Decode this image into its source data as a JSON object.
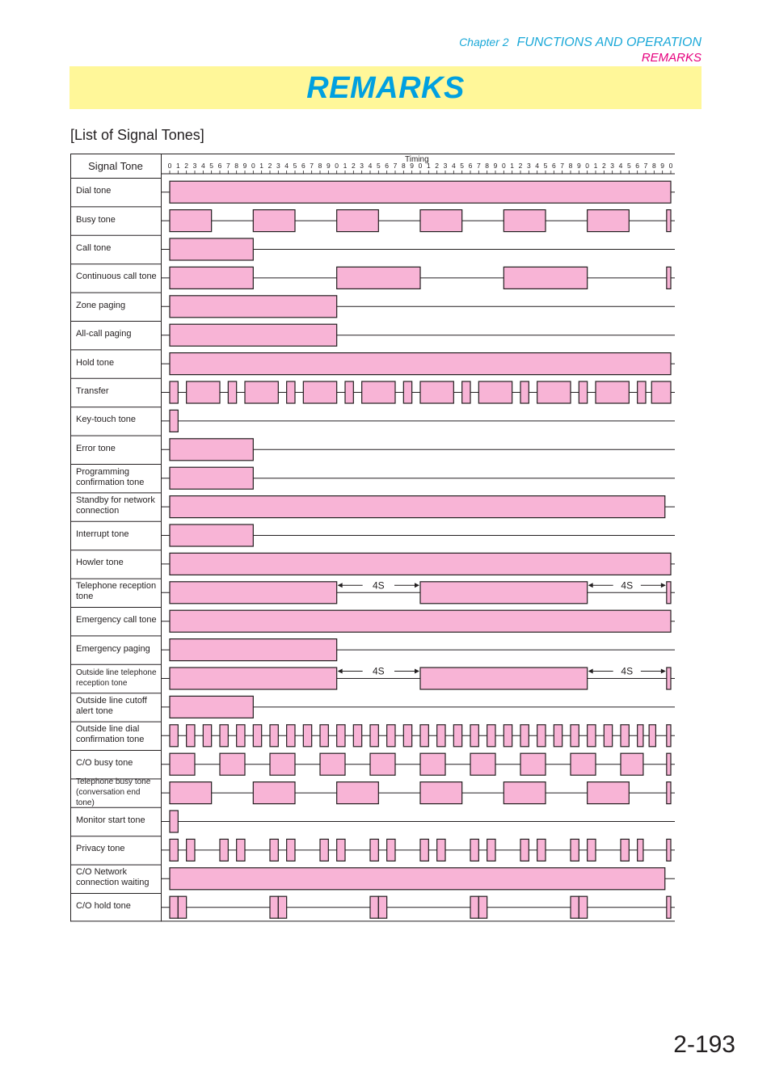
{
  "header": {
    "chapter": "Chapter 2",
    "chapter_title": "FUNCTIONS AND OPERATION",
    "section": "REMARKS"
  },
  "banner": {
    "title": "REMARKS"
  },
  "subtitle": "[List of Signal Tones]",
  "page_number": "2-193",
  "colors": {
    "pulse_fill": "#f8b4d6",
    "line": "#231f20",
    "banner_bg": "#fff799",
    "title_blue": "#00a0e0",
    "section_pink": "#e6007e"
  },
  "chart_data": {
    "type": "timing",
    "title": "List of Signal Tones",
    "column_headers": {
      "label": "Signal Tone",
      "timing": "Timing"
    },
    "timing_ticks": [
      "0",
      "1",
      "2",
      "3",
      "4",
      "5",
      "6",
      "7",
      "8",
      "9",
      "0",
      "1",
      "2",
      "3",
      "4",
      "5",
      "6",
      "7",
      "8",
      "9",
      "0",
      "1",
      "2",
      "3",
      "4",
      "5",
      "6",
      "7",
      "8",
      "9",
      "0",
      "1",
      "2",
      "3",
      "4",
      "5",
      "6",
      "7",
      "8",
      "9",
      "0",
      "1",
      "2",
      "3",
      "4",
      "5",
      "6",
      "7",
      "8",
      "9",
      "0",
      "1",
      "2",
      "3",
      "4",
      "5",
      "6",
      "7",
      "8",
      "9",
      "0"
    ],
    "x_range": [
      0,
      60
    ],
    "rows": [
      {
        "label": "Dial tone",
        "pulses": [
          [
            0,
            60
          ]
        ]
      },
      {
        "label": "Busy tone",
        "pulses": [
          [
            0,
            5
          ],
          [
            10,
            15
          ],
          [
            20,
            25
          ],
          [
            30,
            35
          ],
          [
            40,
            45
          ],
          [
            50,
            55
          ],
          [
            59.5,
            60
          ]
        ]
      },
      {
        "label": "Call tone",
        "pulses": [
          [
            0,
            10
          ]
        ]
      },
      {
        "label": "Continuous call tone",
        "pulses": [
          [
            0,
            10
          ],
          [
            20,
            30
          ],
          [
            40,
            50
          ],
          [
            59.5,
            60
          ]
        ]
      },
      {
        "label": "Zone paging",
        "pulses": [
          [
            0,
            20
          ]
        ]
      },
      {
        "label": "All-call paging",
        "pulses": [
          [
            0,
            20
          ]
        ]
      },
      {
        "label": "Hold tone",
        "pulses": [
          [
            0,
            60
          ]
        ]
      },
      {
        "label": "Transfer",
        "pulses": [
          [
            0,
            1
          ],
          [
            2,
            6
          ],
          [
            7,
            8
          ],
          [
            9,
            13
          ],
          [
            14,
            15
          ],
          [
            16,
            20
          ],
          [
            21,
            22
          ],
          [
            23,
            27
          ],
          [
            28,
            29
          ],
          [
            30,
            34
          ],
          [
            35,
            36
          ],
          [
            37,
            41
          ],
          [
            42,
            43
          ],
          [
            44,
            48
          ],
          [
            49,
            50
          ],
          [
            51,
            55
          ],
          [
            56,
            57
          ],
          [
            57.7,
            60
          ]
        ]
      },
      {
        "label": "Key-touch tone",
        "pulses": [
          [
            0,
            1
          ]
        ]
      },
      {
        "label": "Error tone",
        "pulses": [
          [
            0,
            10
          ]
        ]
      },
      {
        "label": "Programming confirmation tone",
        "pulses": [
          [
            0,
            10
          ]
        ]
      },
      {
        "label": "Standby for network connection",
        "pulses": [
          [
            0,
            59.3
          ]
        ]
      },
      {
        "label": "Interrupt tone",
        "pulses": [
          [
            0,
            10
          ]
        ]
      },
      {
        "label": "Howler tone",
        "pulses": [
          [
            0,
            60
          ]
        ]
      },
      {
        "label": "Telephone reception tone",
        "pulses": [
          [
            0,
            20
          ],
          [
            30,
            50
          ],
          [
            59.5,
            60
          ]
        ],
        "annotations": [
          {
            "text": "4S",
            "from": 20,
            "to": 30
          },
          {
            "text": "4S",
            "from": 50,
            "to": 59.5
          }
        ]
      },
      {
        "label": "Emergency call tone",
        "pulses": [
          [
            0,
            60
          ]
        ]
      },
      {
        "label": "Emergency paging",
        "pulses": [
          [
            0,
            20
          ]
        ]
      },
      {
        "label": "Outside line telephone reception tone",
        "small": true,
        "pulses": [
          [
            0,
            20
          ],
          [
            30,
            50
          ],
          [
            59.5,
            60
          ]
        ],
        "annotations": [
          {
            "text": "4S",
            "from": 20,
            "to": 30
          },
          {
            "text": "4S",
            "from": 50,
            "to": 59.5
          }
        ]
      },
      {
        "label": "Outside line cutoff alert tone",
        "pulses": [
          [
            0,
            10
          ]
        ]
      },
      {
        "label": "Outside line dial confirmation tone",
        "pulses": [
          [
            0,
            1
          ],
          [
            2,
            3
          ],
          [
            4,
            5
          ],
          [
            6,
            7
          ],
          [
            8,
            9
          ],
          [
            10,
            11
          ],
          [
            12,
            13
          ],
          [
            14,
            15
          ],
          [
            16,
            17
          ],
          [
            18,
            19
          ],
          [
            20,
            21
          ],
          [
            22,
            23
          ],
          [
            24,
            25
          ],
          [
            26,
            27
          ],
          [
            28,
            29
          ],
          [
            30,
            31
          ],
          [
            32,
            33
          ],
          [
            34,
            35
          ],
          [
            36,
            37
          ],
          [
            38,
            39
          ],
          [
            40,
            41
          ],
          [
            42,
            43
          ],
          [
            44,
            45
          ],
          [
            46,
            47
          ],
          [
            48,
            49
          ],
          [
            50,
            51
          ],
          [
            52,
            53
          ],
          [
            54,
            55
          ],
          [
            56,
            56.7
          ],
          [
            57.4,
            58.2
          ],
          [
            59.5,
            60
          ]
        ]
      },
      {
        "label": "C/O busy tone",
        "pulses": [
          [
            0,
            3
          ],
          [
            6,
            9
          ],
          [
            12,
            15
          ],
          [
            18,
            21
          ],
          [
            24,
            27
          ],
          [
            30,
            33
          ],
          [
            36,
            39
          ],
          [
            42,
            45
          ],
          [
            48,
            51
          ],
          [
            54,
            56.7
          ],
          [
            59.5,
            60
          ]
        ]
      },
      {
        "label": "Telephone busy tone (conversation end tone)",
        "small": true,
        "pulses": [
          [
            0,
            5
          ],
          [
            10,
            15
          ],
          [
            20,
            25
          ],
          [
            30,
            35
          ],
          [
            40,
            45
          ],
          [
            50,
            55
          ],
          [
            59.5,
            60
          ]
        ]
      },
      {
        "label": "Monitor start tone",
        "pulses": [
          [
            0,
            1
          ]
        ]
      },
      {
        "label": "Privacy tone",
        "pulses": [
          [
            0,
            1
          ],
          [
            2,
            3
          ],
          [
            6,
            7
          ],
          [
            8,
            9
          ],
          [
            12,
            13
          ],
          [
            14,
            15
          ],
          [
            18,
            19
          ],
          [
            20,
            21
          ],
          [
            24,
            25
          ],
          [
            26,
            27
          ],
          [
            30,
            31
          ],
          [
            32,
            33
          ],
          [
            36,
            37
          ],
          [
            38,
            39
          ],
          [
            42,
            43
          ],
          [
            44,
            45
          ],
          [
            48,
            49
          ],
          [
            50,
            51
          ],
          [
            54,
            55
          ],
          [
            56,
            56.7
          ],
          [
            59.5,
            60
          ]
        ]
      },
      {
        "label": "C/O Network connection waiting",
        "pulses": [
          [
            0,
            59.3
          ]
        ]
      },
      {
        "label": "C/O hold tone",
        "pulses": [
          [
            0,
            1
          ],
          [
            1,
            2
          ],
          [
            12,
            13
          ],
          [
            13,
            14
          ],
          [
            24,
            25
          ],
          [
            25,
            26
          ],
          [
            36,
            37
          ],
          [
            37,
            38
          ],
          [
            48,
            49
          ],
          [
            49,
            50
          ],
          [
            59.5,
            60
          ]
        ]
      }
    ]
  }
}
